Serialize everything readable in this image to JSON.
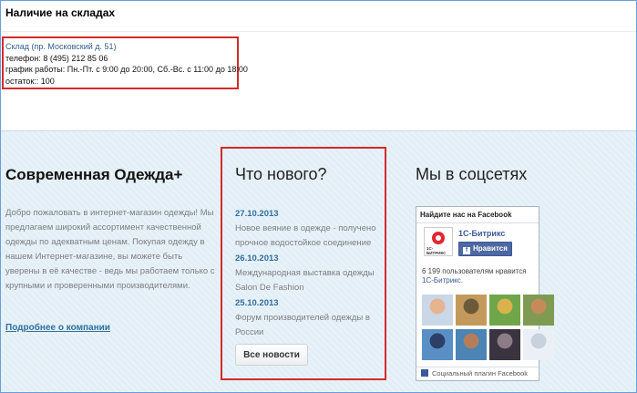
{
  "stock": {
    "title": "Наличие на складах",
    "warehouse_link": "Склад (пр. Московский д. 51)",
    "phone": "телефон: 8 (495) 212 85 06",
    "schedule": "график работы: Пн.-Пт. с 9:00 до 20:00, Сб.-Вс. с 11:00 до 18:00",
    "remaining": "остаток:: 100"
  },
  "about": {
    "title": "Современная Одежда+",
    "text": "Добро пожаловать в интернет-магазин одежды! Мы предлагаем широкий ассортимент качественной одежды по адекватным ценам. Покупая одежду в нашем Интернет-магазине, вы можете быть уверены в её качестве - ведь мы работаем только с крупными и проверенными производителями.",
    "more_link": "Подробнее о компании"
  },
  "news": {
    "title": "Что нового?",
    "items": [
      {
        "date": "27.10.2013",
        "text": "Новое веяние в одежде - получено прочное водостойкое соединение"
      },
      {
        "date": "26.10.2013",
        "text": "Международная выставка одежды Salon De Fashion"
      },
      {
        "date": "25.10.2013",
        "text": "Форум производителей одежды в России"
      }
    ],
    "all_button": "Все новости"
  },
  "social": {
    "title": "Мы в соцсетях",
    "fb_header": "Найдите нас на Facebook",
    "page_name": "1С-Битрикс",
    "logo_text": "1С-БИТРИКС",
    "like_button": "Нравится",
    "like_count_prefix": "6 199 пользователям нравится ",
    "like_count_link": "1С-Битрикс.",
    "footer": "Социальный плагин Facebook",
    "faces": [
      {
        "colors": [
          "#c9d7e6",
          "#e6b48e"
        ]
      },
      {
        "colors": [
          "#c49a5c",
          "#6b5a3a"
        ]
      },
      {
        "colors": [
          "#6fa64a",
          "#d9b24c"
        ]
      },
      {
        "colors": [
          "#7f9a52",
          "#c58a5a"
        ]
      },
      {
        "colors": [
          "#5a8fc6",
          "#2d3f66"
        ]
      },
      {
        "colors": [
          "#4b84b5",
          "#b67d5a"
        ]
      },
      {
        "colors": [
          "#3a3340",
          "#8c7c86"
        ]
      },
      {
        "colors": [
          "#eaf0f5",
          "#c7d2dc"
        ]
      }
    ]
  },
  "colors": {
    "highlight": "#d42a2a",
    "link": "#2f6f9f",
    "facebook": "#3b5998"
  }
}
